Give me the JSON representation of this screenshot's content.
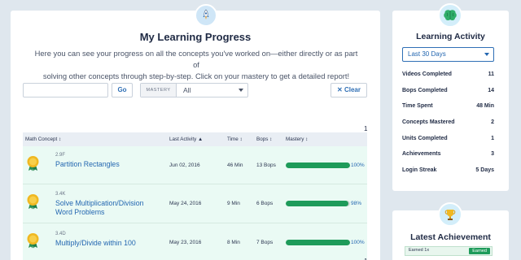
{
  "main": {
    "title": "My Learning Progress",
    "intro_line1": "Here you can see your progress on all the concepts you've worked on—either directly or as part of",
    "intro_line2": "solving other concepts through step-by-step. Click on your mastery to get a detailed report!",
    "search": {
      "value": "",
      "placeholder": ""
    },
    "go_label": "Go",
    "mastery_filter": {
      "tag": "MASTERY",
      "value": "All"
    },
    "clear_label": "✕ Clear",
    "page_top": "1",
    "page_bottom": "1"
  },
  "table": {
    "headers": {
      "concept": "Math Concept ↕",
      "last_activity": "Last Activity ▲",
      "time": "Time ↕",
      "bops": "Bops ↕",
      "mastery": "Mastery ↕"
    },
    "rows": [
      {
        "code": "2.9F",
        "concept": "Partition Rectangles",
        "date": "Jun 02, 2016",
        "time": "46 Min",
        "bops": "13 Bops",
        "mastery_pct": 100,
        "mastery_label": "100%"
      },
      {
        "code": "3.4K",
        "concept": "Solve Multiplication/Division Word Problems",
        "date": "May 24, 2016",
        "time": "9 Min",
        "bops": "6 Bops",
        "mastery_pct": 98,
        "mastery_label": "98%"
      },
      {
        "code": "3.4D",
        "concept": "Multiply/Divide within 100",
        "date": "May 23, 2016",
        "time": "8 Min",
        "bops": "7 Bops",
        "mastery_pct": 100,
        "mastery_label": "100%"
      }
    ]
  },
  "activity": {
    "title": "Learning Activity",
    "period": "Last 30 Days",
    "stats": [
      {
        "label": "Videos Completed",
        "value": "11"
      },
      {
        "label": "Bops Completed",
        "value": "14"
      },
      {
        "label": "Time Spent",
        "value": "48 Min"
      },
      {
        "label": "Concepts Mastered",
        "value": "2"
      },
      {
        "label": "Units Completed",
        "value": "1"
      },
      {
        "label": "Achievements",
        "value": "3"
      },
      {
        "label": "Login Streak",
        "value": "5 Days"
      }
    ]
  },
  "achievement": {
    "title": "Latest Achievement",
    "item_label": "Earned 1x",
    "earned_label": "Earned"
  },
  "colors": {
    "accent": "#2467b1",
    "mastery_green": "#1e9b5a",
    "row_bg": "#eafaf4",
    "page_bg": "#dfe7ee"
  },
  "icons": {
    "main_badge": "rocket-icon",
    "activity_badge": "brain-icon",
    "achievement_badge": "trophy-icon",
    "row_icon": "gold-medal-icon"
  }
}
